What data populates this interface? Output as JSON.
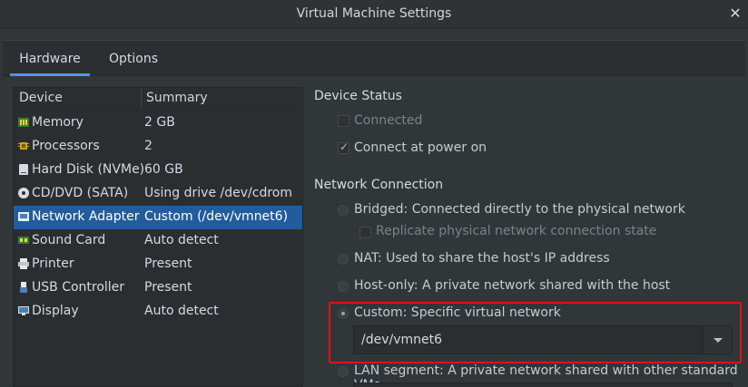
{
  "window": {
    "title": "Virtual Machine Settings"
  },
  "tabs": [
    {
      "label": "Hardware"
    },
    {
      "label": "Options"
    }
  ],
  "device_list": {
    "headers": {
      "device": "Device",
      "summary": "Summary"
    },
    "rows": [
      {
        "device": "Memory",
        "summary": "2 GB",
        "icon": "memory-icon"
      },
      {
        "device": "Processors",
        "summary": "2",
        "icon": "processor-icon"
      },
      {
        "device": "Hard Disk (NVMe)",
        "summary": "60 GB",
        "icon": "hard-disk-icon"
      },
      {
        "device": "CD/DVD (SATA)",
        "summary": "Using drive /dev/cdrom",
        "icon": "cd-dvd-icon"
      },
      {
        "device": "Network Adapter",
        "summary": "Custom (/dev/vmnet6)",
        "icon": "network-adapter-icon",
        "selected": true
      },
      {
        "device": "Sound Card",
        "summary": "Auto detect",
        "icon": "sound-card-icon"
      },
      {
        "device": "Printer",
        "summary": "Present",
        "icon": "printer-icon"
      },
      {
        "device": "USB Controller",
        "summary": "Present",
        "icon": "usb-icon"
      },
      {
        "device": "Display",
        "summary": "Auto detect",
        "icon": "display-icon"
      }
    ]
  },
  "device_status": {
    "title": "Device Status",
    "connected": {
      "label": "Connected",
      "checked": false
    },
    "connect_at_power_on": {
      "label": "Connect at power on",
      "checked": true
    }
  },
  "network_connection": {
    "title": "Network Connection",
    "bridged": {
      "label": "Bridged: Connected directly to the physical network"
    },
    "replicate": {
      "label": "Replicate physical network connection state"
    },
    "nat": {
      "label": "NAT: Used to share the host's IP address"
    },
    "host_only": {
      "label": "Host-only: A private network shared with the host"
    },
    "custom": {
      "label": "Custom: Specific virtual network",
      "selected": true
    },
    "custom_value": "/dev/vmnet6",
    "lan_segment": {
      "label": "LAN segment: A private network shared with other standard VMs"
    }
  },
  "colors": {
    "accent": "#5294e2",
    "selection": "#215d9c",
    "highlight_box": "#e0121a"
  }
}
